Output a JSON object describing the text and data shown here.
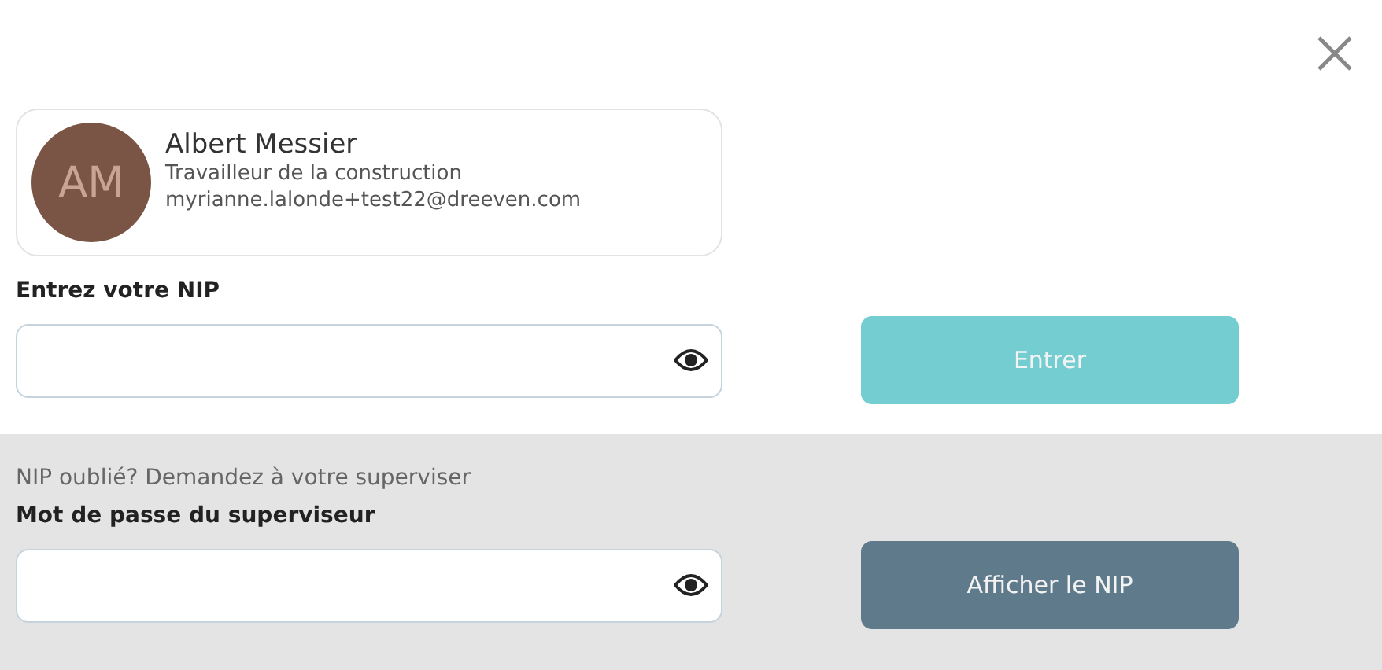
{
  "profile": {
    "initials": "AM",
    "name": "Albert Messier",
    "role": "Travailleur de la construction",
    "email": "myrianne.lalonde+test22@dreeven.com"
  },
  "pin": {
    "label": "Entrez votre NIP",
    "button": {
      "label": "Entrer",
      "disabled": true
    }
  },
  "supervisor": {
    "hint": "NIP oublié? Demandez à votre superviser",
    "label": "Mot de passe du superviseur",
    "button": {
      "label": "Afficher le NIP",
      "disabled": false
    }
  }
}
